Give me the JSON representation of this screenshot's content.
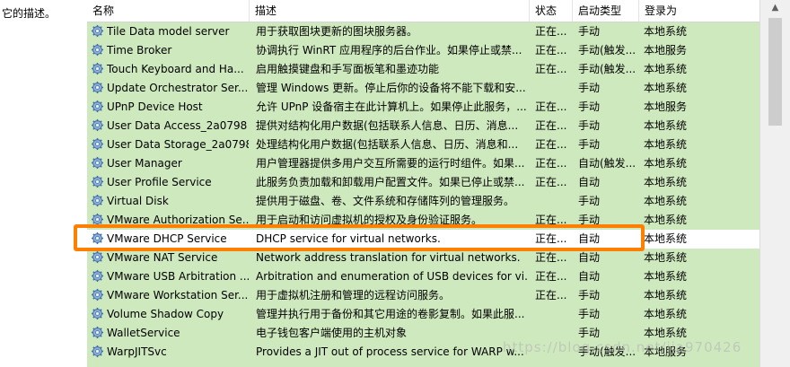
{
  "left_panel": {
    "description_label": "它的描述。"
  },
  "header": {
    "columns": [
      "名称",
      "描述",
      "状态",
      "启动类型",
      "登录为"
    ]
  },
  "services": [
    {
      "name": "Tile Data model server",
      "description": "用于获取图块更新的图块服务器。",
      "status": "正在...",
      "startup": "手动",
      "logon": "本地系统"
    },
    {
      "name": "Time Broker",
      "description": "协调执行 WinRT 应用程序的后台作业。如果停止或禁...",
      "status": "正在...",
      "startup": "手动(触发...",
      "logon": "本地服务"
    },
    {
      "name": "Touch Keyboard and Ha...",
      "description": "启用触摸键盘和手写面板笔和墨迹功能",
      "status": "正在...",
      "startup": "手动(触发...",
      "logon": "本地系统"
    },
    {
      "name": "Update Orchestrator Ser...",
      "description": "管理 Windows 更新。停止后你的设备将不能下载和安...",
      "status": "",
      "startup": "手动",
      "logon": "本地系统"
    },
    {
      "name": "UPnP Device Host",
      "description": "允许 UPnP 设备宿主在此计算机上。如果停止此服务，...",
      "status": "正在...",
      "startup": "手动",
      "logon": "本地服务"
    },
    {
      "name": "User Data Access_2a0798",
      "description": "提供对结构化用户数据(包括联系人信息、日历、消息...",
      "status": "正在...",
      "startup": "手动",
      "logon": "本地系统"
    },
    {
      "name": "User Data Storage_2a0798",
      "description": "处理结构化用户数据(包括联系人信息、日历、消息和...",
      "status": "正在...",
      "startup": "手动",
      "logon": "本地系统"
    },
    {
      "name": "User Manager",
      "description": "用户管理器提供多用户交互所需要的运行时组件。如果...",
      "status": "正在...",
      "startup": "自动(触发...",
      "logon": "本地系统"
    },
    {
      "name": "User Profile Service",
      "description": "此服务负责加载和卸载用户配置文件。如果已停止或禁...",
      "status": "正在...",
      "startup": "自动",
      "logon": "本地系统"
    },
    {
      "name": "Virtual Disk",
      "description": "提供用于磁盘、卷、文件系统和存储阵列的管理服务。",
      "status": "",
      "startup": "手动",
      "logon": "本地系统"
    },
    {
      "name": "VMware Authorization Se...",
      "description": "用于启动和访问虚拟机的授权及身份验证服务。",
      "status": "正在...",
      "startup": "手动",
      "logon": "本地系统"
    },
    {
      "name": "VMware DHCP Service",
      "description": "DHCP service for virtual networks.",
      "status": "正在...",
      "startup": "自动",
      "logon": "本地系统",
      "selected": true
    },
    {
      "name": "VMware NAT Service",
      "description": "Network address translation for virtual networks.",
      "status": "正在...",
      "startup": "自动",
      "logon": "本地系统"
    },
    {
      "name": "VMware USB Arbitration ...",
      "description": "Arbitration and enumeration of USB devices for vi...",
      "status": "正在...",
      "startup": "自动",
      "logon": "本地系统"
    },
    {
      "name": "VMware Workstation Ser...",
      "description": "用于虚拟机注册和管理的远程访问服务。",
      "status": "正在...",
      "startup": "手动",
      "logon": "本地系统"
    },
    {
      "name": "Volume Shadow Copy",
      "description": "管理并执行用于备份和其它用途的卷影复制。如果此服...",
      "status": "",
      "startup": "手动",
      "logon": "本地系统"
    },
    {
      "name": "WalletService",
      "description": "电子钱包客户端使用的主机对象",
      "status": "",
      "startup": "手动",
      "logon": "本地系统"
    },
    {
      "name": "WarpJITSvc",
      "description": "Provides a JIT out of process service for WARP w...",
      "status": "",
      "startup": "手动(触发...",
      "logon": "本地服务"
    }
  ],
  "watermark": "https://blog.csdn.net/jia970426",
  "colors": {
    "row_bg": "#cfe9bf",
    "selected_bg": "#ffffff",
    "highlight": "#ff7f00"
  }
}
